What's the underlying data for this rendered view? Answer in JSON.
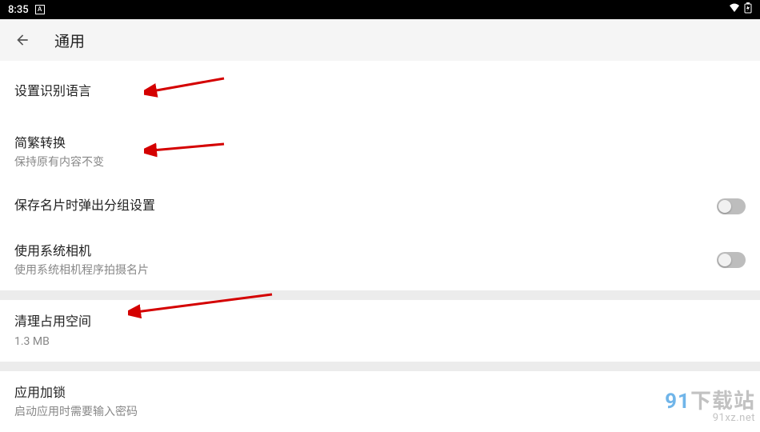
{
  "status": {
    "time": "8:35",
    "indicator": "A"
  },
  "appbar": {
    "title": "通用"
  },
  "rows": {
    "recognize_lang": {
      "title": "设置识别语言"
    },
    "convert": {
      "title": "简繁转换",
      "sub": "保持原有内容不变"
    },
    "group_popup": {
      "title": "保存名片时弹出分组设置"
    },
    "system_camera": {
      "title": "使用系统相机",
      "sub": "使用系统相机程序拍摄名片"
    },
    "clear_space": {
      "title": "清理占用空间",
      "sub": "1.3 MB"
    },
    "app_lock": {
      "title": "应用加锁",
      "sub": "启动应用时需要输入密码"
    }
  },
  "watermark": {
    "top_a": "91",
    "top_b": "下载站",
    "bottom": "91xz.net"
  }
}
